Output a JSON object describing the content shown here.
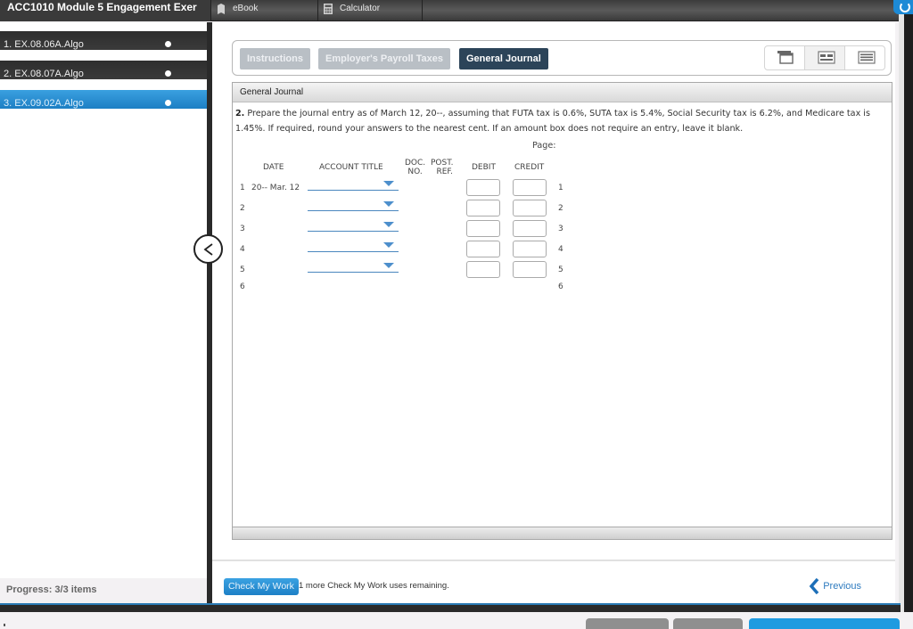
{
  "app": {
    "title": "ACC1010 Module 5 Engagement Exer",
    "top_tabs": [
      {
        "label": "eBook",
        "icon": "book-icon"
      },
      {
        "label": "Calculator",
        "icon": "calculator-icon"
      }
    ]
  },
  "sidebar": {
    "items": [
      {
        "label": "1. EX.08.06A.Algo",
        "status": "dot"
      },
      {
        "label": "2. EX.08.07A.Algo",
        "status": "dot"
      },
      {
        "label": "3. EX.09.02A.Algo",
        "status": "dot",
        "active": true
      }
    ],
    "progress": "Progress: 3/3 items"
  },
  "question_tabs": [
    {
      "label": "Instructions",
      "active": false
    },
    {
      "label": "Employer's Payroll Taxes",
      "active": false
    },
    {
      "label": "General Journal",
      "active": true
    }
  ],
  "view_buttons": [
    "overlay-view-icon",
    "split-view-icon",
    "full-view-icon"
  ],
  "journal": {
    "panel_title": "General Journal",
    "question_number": "2.",
    "prompt": "Prepare the journal entry as of March 12, 20--, assuming that FUTA tax is 0.6%, SUTA tax is 5.4%, Social Security tax is 6.2%, and Medicare tax is 1.45%. If required, round your answers to the nearest cent. If an amount box does not require an entry, leave it blank.",
    "page_label": "Page:",
    "headers": {
      "date": "DATE",
      "account_title": "ACCOUNT TITLE",
      "doc_no_1": "DOC.",
      "doc_no_2": "NO.",
      "post_ref_1": "POST.",
      "post_ref_2": "REF.",
      "debit": "DEBIT",
      "credit": "CREDIT"
    },
    "rows": [
      {
        "num": "1",
        "date": "20-- Mar. 12",
        "account": "",
        "debit": "",
        "credit": "",
        "editable": true
      },
      {
        "num": "2",
        "date": "",
        "account": "",
        "debit": "",
        "credit": "",
        "editable": true
      },
      {
        "num": "3",
        "date": "",
        "account": "",
        "debit": "",
        "credit": "",
        "editable": true
      },
      {
        "num": "4",
        "date": "",
        "account": "",
        "debit": "",
        "credit": "",
        "editable": true
      },
      {
        "num": "5",
        "date": "",
        "account": "",
        "debit": "",
        "credit": "",
        "editable": true
      },
      {
        "num": "6",
        "date": "",
        "editable": false
      }
    ]
  },
  "actions": {
    "check_my_work": "Check My Work",
    "check_note": "1 more Check My Work uses remaining.",
    "previous": "Previous"
  },
  "colors": {
    "accent_blue": "#1d80c6",
    "active_tab": "#2c4459",
    "inactive_tab": "#b9bfc5"
  }
}
